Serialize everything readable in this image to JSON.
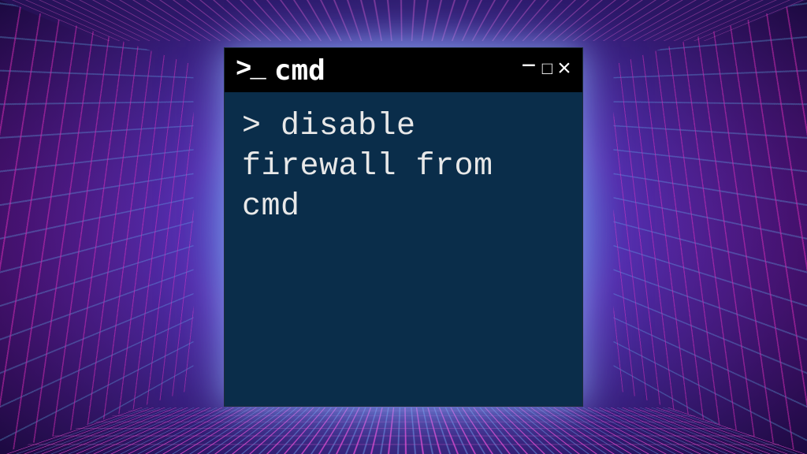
{
  "window": {
    "title": "cmd",
    "icon_prompt": ">_",
    "controls": {
      "minimize": "–",
      "maximize": "□",
      "close": "×"
    }
  },
  "terminal": {
    "prompt": ">",
    "command": "disable firewall from cmd"
  },
  "colors": {
    "terminal_bg": "#0a2d4a",
    "titlebar_bg": "#000000",
    "text": "#e8e8e8"
  }
}
